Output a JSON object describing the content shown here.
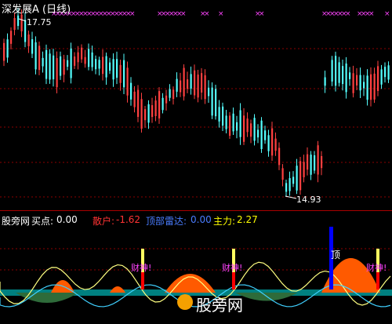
{
  "header": {
    "title": "深发展A (日线)",
    "high_label": "17.75",
    "low_label": "14.93"
  },
  "indicator": {
    "name": "股旁网",
    "items": [
      {
        "label": "买点:",
        "value": "0.00",
        "color": "#ffffff"
      },
      {
        "label": "散户:",
        "value": "-1.62",
        "color": "#ff3333"
      },
      {
        "label": "顶部雷达:",
        "value": "0.00",
        "color": "#4a7dff"
      },
      {
        "label": "主力:",
        "value": "2.27",
        "color": "#ffff00"
      }
    ],
    "signal_text": "财神!",
    "top_text": "顶"
  },
  "watermark": "股旁网",
  "colors": {
    "background": "#000000",
    "up": "#ff4040",
    "down": "#54ffff",
    "marker": "#ff44ff",
    "grid": "#8b0000",
    "orange": "#ff5a00",
    "yellow": "#ffff00",
    "blue": "#0000ff"
  }
}
